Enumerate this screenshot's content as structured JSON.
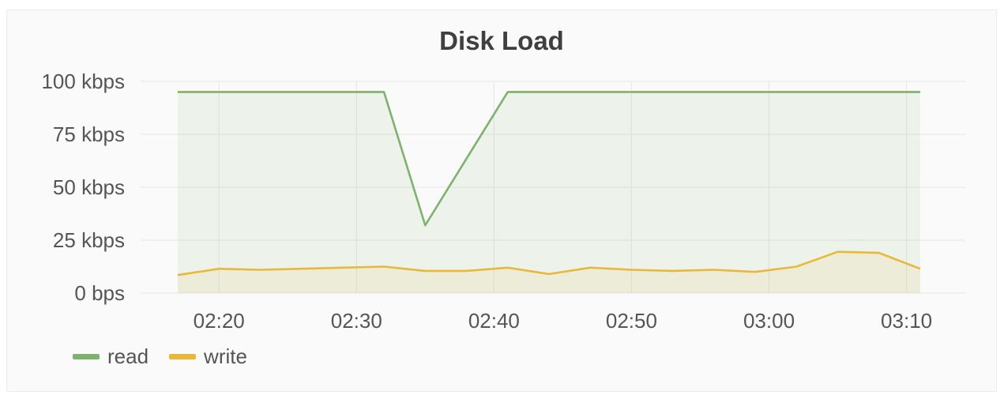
{
  "colors": {
    "read": "#7eb26d",
    "write": "#eab839",
    "grid": "#e9e9e9",
    "axis_text": "#555555"
  },
  "chart_data": {
    "type": "area",
    "title": "Disk Load",
    "xlabel": "",
    "ylabel": "",
    "ylim": [
      0,
      100
    ],
    "y_ticks": [
      {
        "value": 0,
        "label": "0 bps"
      },
      {
        "value": 25,
        "label": "25 kbps"
      },
      {
        "value": 50,
        "label": "50 kbps"
      },
      {
        "value": 75,
        "label": "75 kbps"
      },
      {
        "value": 100,
        "label": "100 kbps"
      }
    ],
    "xlim": [
      "02:17",
      "03:11"
    ],
    "x_ticks": [
      "02:20",
      "02:30",
      "02:40",
      "02:50",
      "03:00",
      "03:10"
    ],
    "grid": true,
    "legend": "bottom-left",
    "series": [
      {
        "name": "read",
        "x": [
          "02:17",
          "02:32",
          "02:35",
          "02:41",
          "03:11"
        ],
        "values": [
          95,
          95,
          32,
          95,
          95
        ]
      },
      {
        "name": "write",
        "x": [
          "02:17",
          "02:20",
          "02:23",
          "02:26",
          "02:29",
          "02:32",
          "02:35",
          "02:38",
          "02:41",
          "02:44",
          "02:47",
          "02:50",
          "02:53",
          "02:56",
          "02:59",
          "03:02",
          "03:05",
          "03:08",
          "03:11"
        ],
        "values": [
          8.5,
          11.5,
          11,
          11.5,
          12,
          12.5,
          10.5,
          10.5,
          12,
          9,
          12,
          11,
          10.5,
          11,
          10,
          12.5,
          19.5,
          19,
          11.5
        ]
      }
    ]
  }
}
